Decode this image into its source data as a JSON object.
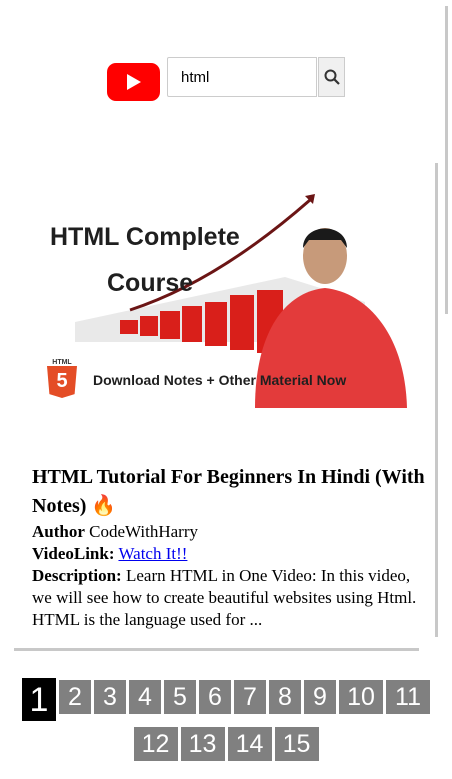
{
  "search": {
    "value": "html",
    "placeholder": ""
  },
  "video": {
    "thumbnail": {
      "title_line1": "HTML Complete",
      "title_line2": "Course",
      "badge_label": "HTML",
      "badge_number": "5",
      "caption": "Download Notes + Other Material Now"
    },
    "title": "HTML Tutorial For Beginners In Hindi (With Notes) 🔥",
    "author_label": "Author",
    "author": "CodeWithHarry",
    "link_label": "VideoLink:",
    "link_text": "Watch It!!",
    "description_label": "Description:",
    "description": "Learn HTML in One Video: In this video, we will see how to create beautiful websites using Html. HTML is the language used for ..."
  },
  "pagination": {
    "active": "1",
    "pages": [
      "2",
      "3",
      "4",
      "5",
      "6",
      "7",
      "8",
      "9",
      "10",
      "11",
      "12",
      "13",
      "14",
      "15"
    ]
  },
  "colors": {
    "youtube_red": "#ff0000",
    "page_inactive": "#808080",
    "page_active": "#000000",
    "link": "#0000ee"
  }
}
